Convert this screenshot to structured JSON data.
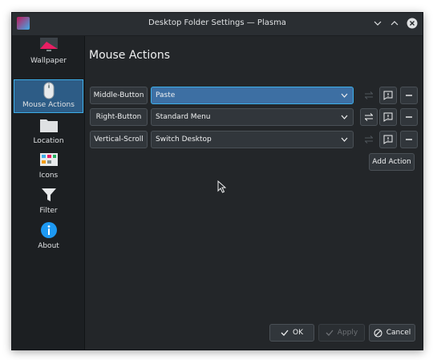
{
  "window": {
    "title": "Desktop Folder Settings — Plasma"
  },
  "titlebar_buttons": [
    "chevron-down-icon",
    "chevron-up-icon",
    "close-icon"
  ],
  "sidebar": {
    "items": [
      {
        "label": "Wallpaper",
        "icon": "wallpaper-icon",
        "selected": false
      },
      {
        "label": "Mouse Actions",
        "icon": "mouse-icon",
        "selected": true
      },
      {
        "label": "Location",
        "icon": "folder-icon",
        "selected": false
      },
      {
        "label": "Icons",
        "icon": "icons-grid-icon",
        "selected": false
      },
      {
        "label": "Filter",
        "icon": "filter-icon",
        "selected": false
      },
      {
        "label": "About",
        "icon": "info-icon",
        "selected": false
      }
    ]
  },
  "page": {
    "title": "Mouse Actions"
  },
  "actions": [
    {
      "trigger": "Middle-Button",
      "plugin": "Paste",
      "configure_enabled": false
    },
    {
      "trigger": "Right-Button",
      "plugin": "Standard Menu",
      "configure_enabled": true
    },
    {
      "trigger": "Vertical-Scroll",
      "plugin": "Switch Desktop",
      "configure_enabled": false
    }
  ],
  "add_action_label": "Add Action",
  "footer": {
    "ok_label": "OK",
    "apply_label": "Apply",
    "cancel_label": "Cancel"
  },
  "colors": {
    "accent": "#3daee9",
    "background": "#232629",
    "selected": "#2d5c86"
  }
}
